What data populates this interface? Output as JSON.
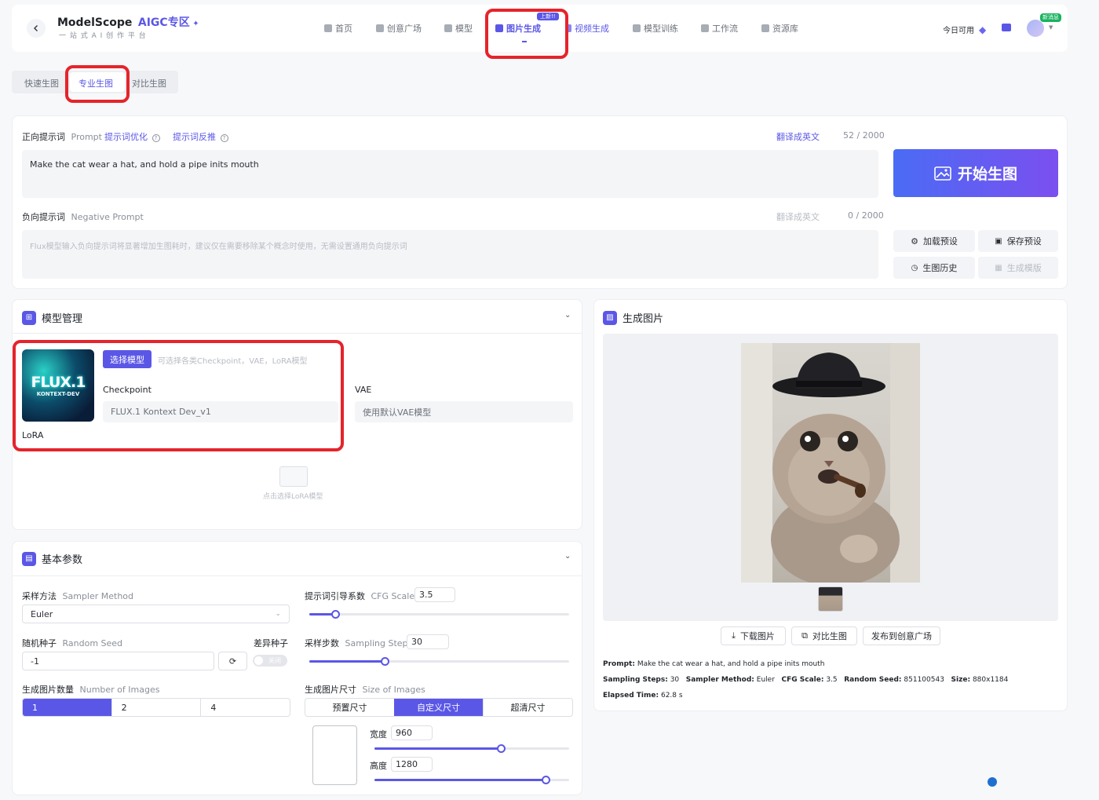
{
  "header": {
    "back_icon": "chevron-left-icon",
    "brand_name": "ModelScope",
    "brand_zone": "AIGC专区",
    "brand_sub": "一 站 式 A I 创 作 平 台",
    "nav": [
      {
        "label": "首页"
      },
      {
        "label": "创意广场"
      },
      {
        "label": "模型"
      },
      {
        "label": "图片生成",
        "badge": "上新!!"
      },
      {
        "label": "视频生成"
      },
      {
        "label": "模型训练"
      },
      {
        "label": "工作流"
      },
      {
        "label": "资源库"
      }
    ],
    "today_available": "今日可用",
    "new_badge": "新消息"
  },
  "mode_tabs": [
    "快速生图",
    "专业生图",
    "对比生图"
  ],
  "prompt": {
    "label": "正向提示词",
    "label_en": "Prompt",
    "optimize": "提示词优化",
    "reverse": "提示词反推",
    "translate": "翻译成英文",
    "count": "52 / 2000",
    "value": "Make the cat wear a hat, and hold a pipe inits mouth"
  },
  "negative": {
    "label": "负向提示词",
    "label_en": "Negative Prompt",
    "translate": "翻译成英文",
    "count": "0 / 2000",
    "placeholder": "Flux模型输入负向提示词将显著增加生图耗时，建议仅在需要移除某个概念时使用，无需设置通用负向提示词"
  },
  "actions": {
    "generate": "开始生图",
    "load_preset": "加载预设",
    "save_preset": "保存预设",
    "history": "生图历史",
    "template": "生成模版"
  },
  "model_mgmt": {
    "title": "模型管理",
    "thumb_title": "FLUX.1",
    "thumb_sub": "KONTEXT-DEV",
    "select_btn": "选择模型",
    "select_hint": "可选择各类Checkpoint，VAE，LoRA模型",
    "checkpoint_label": "Checkpoint",
    "checkpoint_value": "FLUX.1 Kontext Dev_v1",
    "vae_label": "VAE",
    "vae_value": "使用默认VAE模型",
    "lora_label": "LoRA",
    "lora_hint": "点击选择LoRA模型"
  },
  "basic_params": {
    "title": "基本参数",
    "sampler_label": "采样方法",
    "sampler_label_en": "Sampler Method",
    "sampler_value": "Euler",
    "cfg_label": "提示词引导系数",
    "cfg_label_en": "CFG Scale",
    "cfg_value": "3.5",
    "cfg_fraction": 0.1,
    "seed_label": "随机种子",
    "seed_label_en": "Random Seed",
    "seed_value": "-1",
    "variation_label": "差异种子",
    "toggle_text": "关闭",
    "steps_label": "采样步数",
    "steps_label_en": "Sampling Steps",
    "steps_value": "30",
    "steps_fraction": 0.29,
    "num_label": "生成图片数量",
    "num_label_en": "Number of Images",
    "num_options": [
      "1",
      "2",
      "4"
    ],
    "size_label": "生成图片尺寸",
    "size_label_en": "Size of Images",
    "size_options": [
      "预置尺寸",
      "自定义尺寸",
      "超清尺寸"
    ],
    "width_label": "宽度",
    "width_value": "960",
    "width_fraction": 0.65,
    "height_label": "高度",
    "height_value": "1280",
    "height_fraction": 0.88
  },
  "result": {
    "title": "生成图片",
    "download": "下载图片",
    "compare": "对比生图",
    "publish": "发布到创意广场",
    "prompt_key": "Prompt:",
    "prompt_val": "Make the cat wear a hat, and hold a pipe inits mouth",
    "steps_key": "Sampling Steps:",
    "steps_val": "30",
    "sampler_key": "Sampler Method:",
    "sampler_val": "Euler",
    "cfg_key": "CFG Scale:",
    "cfg_val": "3.5",
    "seed_key": "Random Seed:",
    "seed_val": "851100543",
    "size_key": "Size:",
    "size_val": "880x1184",
    "elapsed_key": "Elapsed Time:",
    "elapsed_val": "62.8 s"
  },
  "colors": {
    "accent": "#5b57e6",
    "highlight": "#e5242b"
  }
}
